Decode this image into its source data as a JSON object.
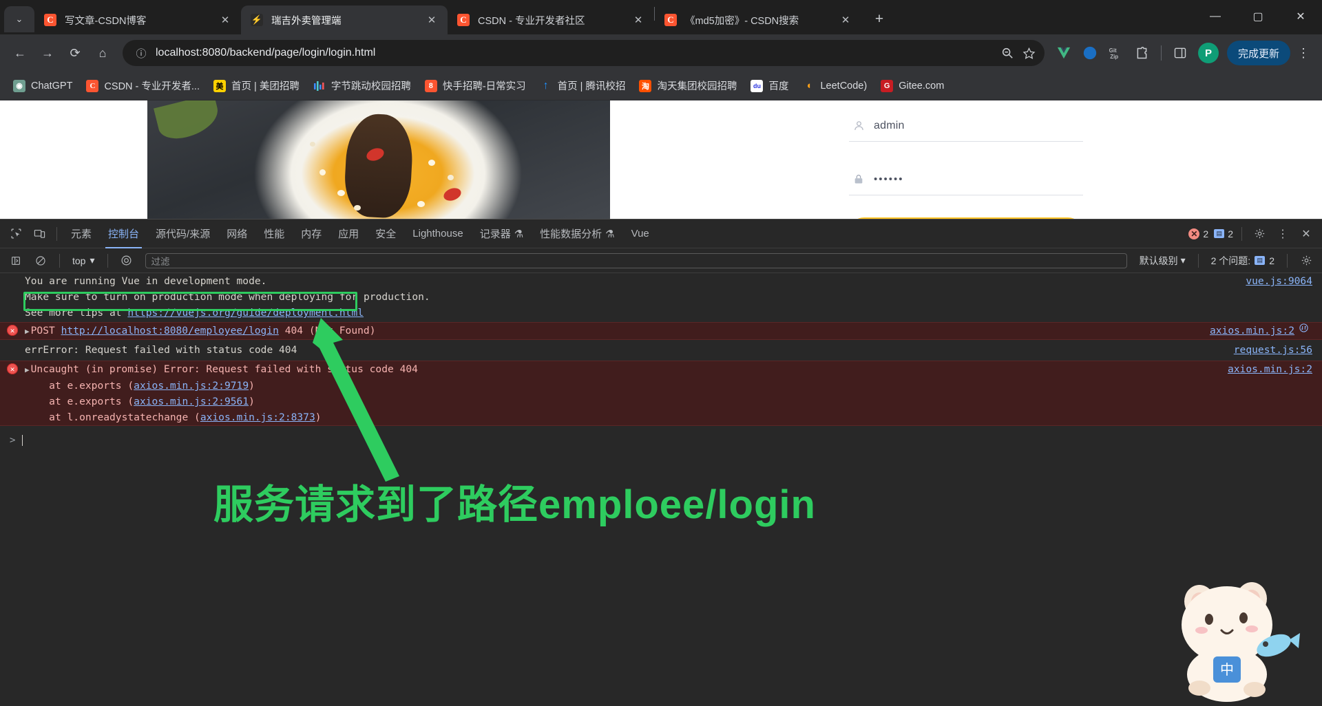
{
  "browser": {
    "tab_list_icon": "chevron-down-icon",
    "tabs": [
      {
        "title": "写文章-CSDN博客",
        "favicon": "csdn-icon",
        "favicon_text": "C",
        "active": false,
        "close_label": "✕"
      },
      {
        "title": "瑞吉外卖管理端",
        "favicon": "reggie-icon",
        "favicon_text": "⚡",
        "active": true,
        "close_label": "✕"
      },
      {
        "title": "CSDN - 专业开发者社区",
        "favicon": "csdn-icon",
        "favicon_text": "C",
        "active": false,
        "close_label": "✕"
      },
      {
        "title": "《md5加密》- CSDN搜索",
        "favicon": "csdn-icon",
        "favicon_text": "C",
        "active": false,
        "close_label": "✕"
      }
    ],
    "new_tab_label": "+",
    "window_controls": {
      "minimize": "—",
      "maximize": "▢",
      "close": "✕"
    },
    "nav": {
      "back": "←",
      "forward": "→",
      "reload": "⟳",
      "home": "⌂",
      "site_info_icon": "info-circle-icon",
      "url": "localhost:8080/backend/page/login/login.html",
      "zoom_out_icon": "search-minus-icon",
      "bookmark_icon": "star-icon",
      "extensions": [
        "vue-devtools-icon",
        "octotree-icon",
        "gitzip-icon",
        "puzzle-icon"
      ],
      "side_panel_icon": "side-panel-icon",
      "profile_initial": "P",
      "update_label": "完成更新",
      "menu_icon": "kebab-menu-icon"
    },
    "bookmarks": [
      {
        "label": "ChatGPT",
        "icon": "chatgpt-icon",
        "icon_text": "◉",
        "color": "#6f9e90"
      },
      {
        "label": "CSDN - 专业开发者...",
        "icon": "csdn-icon",
        "icon_text": "C",
        "color": "#fc5531"
      },
      {
        "label": "首页 | 美团招聘",
        "icon": "meituan-icon",
        "icon_text": "美",
        "color": "#ffd100"
      },
      {
        "label": "字节跳动校园招聘",
        "icon": "bytedance-icon",
        "icon_text": "⊪",
        "color": "#2b2b2b"
      },
      {
        "label": "快手招聘-日常实习",
        "icon": "kuaishou-icon",
        "icon_text": "8",
        "color": "#fc5531"
      },
      {
        "label": "首页 | 腾讯校招",
        "icon": "tencent-icon",
        "icon_text": "↑",
        "color": "#2b2b2b"
      },
      {
        "label": "淘天集团校园招聘",
        "icon": "taobao-icon",
        "icon_text": "淘",
        "color": "#ff5000"
      },
      {
        "label": "百度",
        "icon": "baidu-icon",
        "icon_text": "du",
        "color": "#2932e1"
      },
      {
        "label": "LeetCode)",
        "icon": "leetcode-icon",
        "icon_text": "◐",
        "color": "#2b2b2b"
      },
      {
        "label": "Gitee.com",
        "icon": "gitee-icon",
        "icon_text": "G",
        "color": "#c71d23"
      }
    ]
  },
  "page": {
    "login": {
      "username_icon": "user-icon",
      "username_value": "admin",
      "password_icon": "lock-icon",
      "password_value": "••••••",
      "submit_color": "#ffc21f"
    }
  },
  "devtools": {
    "inspect_icon": "inspect-element-icon",
    "device_icon": "device-toolbar-icon",
    "tabs": [
      {
        "label": "元素",
        "active": false
      },
      {
        "label": "控制台",
        "active": true
      },
      {
        "label": "源代码/来源",
        "active": false
      },
      {
        "label": "网络",
        "active": false
      },
      {
        "label": "性能",
        "active": false
      },
      {
        "label": "内存",
        "active": false
      },
      {
        "label": "应用",
        "active": false
      },
      {
        "label": "安全",
        "active": false
      },
      {
        "label": "Lighthouse",
        "active": false
      },
      {
        "label": "记录器",
        "active": false,
        "beaker": "⚗"
      },
      {
        "label": "性能数据分析",
        "active": false,
        "beaker": "⚗"
      },
      {
        "label": "Vue",
        "active": false
      }
    ],
    "error_count": "2",
    "message_count": "2",
    "settings_icon": "gear-icon",
    "more_icon": "kebab-menu-icon",
    "close_icon": "close-icon",
    "console_toolbar": {
      "sidebar_icon": "console-sidebar-icon",
      "clear_icon": "clear-console-icon",
      "context": "top",
      "context_caret": "▾",
      "eye_icon": "live-expression-icon",
      "filter_placeholder": "过滤",
      "level_label": "默认级别",
      "level_caret": "▾",
      "issues_label": "2 个问题:",
      "issues_count": "2",
      "settings_icon": "gear-icon"
    },
    "messages": [
      {
        "type": "info",
        "lines": [
          "You are running Vue in development mode.",
          "Make sure to turn on production mode when deploying for production.",
          "See more tips at "
        ],
        "link": "https://vuejs.org/guide/deployment.html",
        "source": "vue.js:9064"
      },
      {
        "type": "error",
        "expander": "▶",
        "method": "POST",
        "url": "http://localhost:8080/employee/login",
        "status": "404 (Not Found)",
        "source": "axios.min.js:2",
        "network_icon": "network-request-icon"
      },
      {
        "type": "plain",
        "text": "errError: Request failed with status code 404",
        "source": "request.js:56"
      },
      {
        "type": "error",
        "expander": "▶",
        "text": "Uncaught (in promise) Error: Request failed with status code 404",
        "stack": [
          {
            "prefix": "    at e.exports (",
            "link": "axios.min.js:2:9719",
            "suffix": ")"
          },
          {
            "prefix": "    at e.exports (",
            "link": "axios.min.js:2:9561",
            "suffix": ")"
          },
          {
            "prefix": "    at l.onreadystatechange (",
            "link": "axios.min.js:2:8373",
            "suffix": ")"
          }
        ],
        "source": "axios.min.js:2"
      }
    ],
    "prompt_caret": ">"
  },
  "annotation": {
    "text": "服务请求到了路径emploee/login",
    "color": "#2ecc5f",
    "highlight_color": "#2ecc5f"
  }
}
